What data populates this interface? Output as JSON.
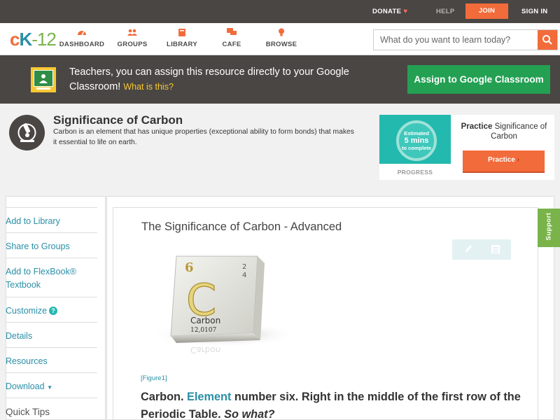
{
  "topbar": {
    "donate": "DONATE",
    "help": "HELP",
    "join": "JOIN",
    "signin": "SIGN IN"
  },
  "logo": {
    "c": "c",
    "k": "K",
    "n": "-12"
  },
  "nav": [
    {
      "label": "DASHBOARD",
      "icon": "dashboard-icon"
    },
    {
      "label": "GROUPS",
      "icon": "groups-icon"
    },
    {
      "label": "LIBRARY",
      "icon": "library-icon"
    },
    {
      "label": "CAFE",
      "icon": "cafe-icon"
    },
    {
      "label": "BROWSE",
      "icon": "browse-icon"
    }
  ],
  "search": {
    "placeholder": "What do you want to learn today?"
  },
  "banner": {
    "text": "Teachers, you can assign this resource directly to your Google Classroom!",
    "what": "What is this?",
    "button": "Assign to Google Classroom"
  },
  "concept": {
    "title": "Significance of Carbon",
    "description": "Carbon is an element that has unique properties (exceptional ability to form bonds) that makes it essential to life on earth."
  },
  "practice": {
    "ring_line1": "Estimated",
    "ring_line2": "5 mins",
    "ring_line3": "to complete",
    "progress": "PROGRESS",
    "title_bold": "Practice",
    "title_rest": "Significance of Carbon",
    "button": "Practice"
  },
  "sidebar": {
    "items": [
      "Add to Library",
      "Share to Groups",
      "Add to FlexBook®",
      "Textbook",
      "Customize",
      "Details",
      "Resources",
      "Download",
      "Quick Tips"
    ]
  },
  "article": {
    "title": "The Significance of Carbon - Advanced",
    "element": {
      "number": "6",
      "symbol": "C",
      "name": "Carbon",
      "mass": "12,0107",
      "shells_top": "2",
      "shells_bottom": "4"
    },
    "figure_caption": "[Figure1]",
    "body_1": "Carbon. ",
    "body_link": "Element",
    "body_2": " number six. Right in the middle of the first row of the Periodic Table. ",
    "body_3": "So what?"
  },
  "support": "Support",
  "colors": {
    "orange": "#f26b3a",
    "teal": "#2a8fa6",
    "green": "#23a052",
    "dark": "#4a4644"
  }
}
